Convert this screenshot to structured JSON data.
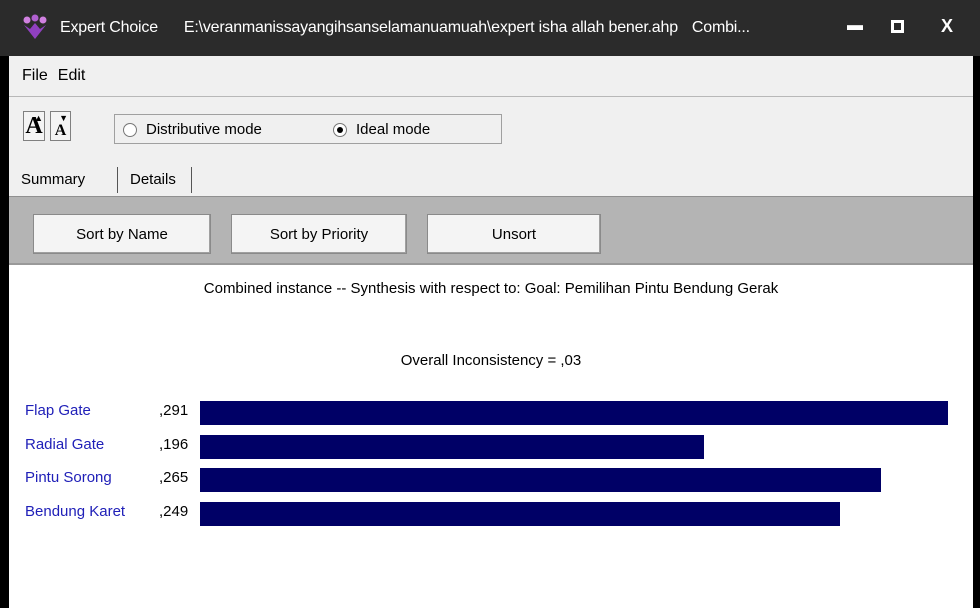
{
  "titlebar": {
    "app_name": "Expert Choice",
    "file_path": "E:\\veranmanissayangihsanselamanuamuah\\expert isha allah bener.ahp",
    "mode_truncated": "Combi...",
    "minimize_glyph": "▬",
    "maximize_glyph": "▣",
    "close_glyph": "X"
  },
  "menu": {
    "file": "File",
    "edit": "Edit"
  },
  "toolbar": {
    "font_larger": "A",
    "font_smaller": "A",
    "mode_distributive": "Distributive mode",
    "mode_ideal": "Ideal mode",
    "selected_mode": "ideal"
  },
  "tabs": {
    "summary": "Summary",
    "details": "Details"
  },
  "buttons": {
    "sort_name": "Sort by Name",
    "sort_priority": "Sort by Priority",
    "unsort": "Unsort"
  },
  "synthesis": {
    "heading": "Combined instance -- Synthesis with respect to: Goal: Pemilihan Pintu Bendung Gerak",
    "inconsistency": "Overall Inconsistency = ,03"
  },
  "chart_data": {
    "type": "bar",
    "categories": [
      "Flap Gate",
      "Radial Gate",
      "Pintu Sorong",
      "Bendung Karet"
    ],
    "values": [
      0.291,
      0.196,
      0.265,
      0.249
    ],
    "value_labels": [
      ",291",
      ",196",
      ",265",
      ",249"
    ],
    "bar_color": "#000066",
    "label_color": "#2020b8"
  },
  "colors": {
    "titlebar": "#2b2b2b",
    "panel": "#f0f0f0",
    "button_bar": "#b4b4b4"
  }
}
